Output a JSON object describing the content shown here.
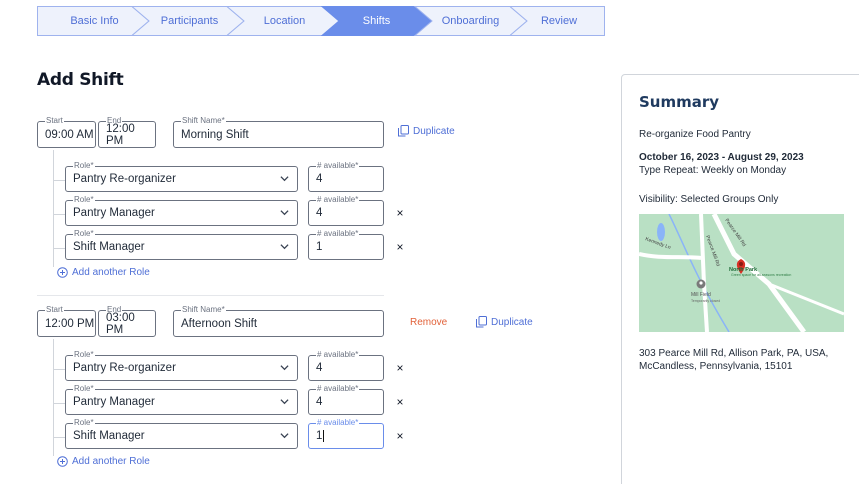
{
  "stepper": {
    "steps": [
      {
        "label": "Basic Info"
      },
      {
        "label": "Participants"
      },
      {
        "label": "Location"
      },
      {
        "label": "Shifts"
      },
      {
        "label": "Onboarding"
      },
      {
        "label": "Review"
      }
    ],
    "active_index": 3,
    "active_color": "#6a8dea"
  },
  "page": {
    "title": "Add Shift"
  },
  "labels": {
    "start": "Start",
    "end": "End",
    "shift_name": "Shift Name*",
    "role": "Role*",
    "available": "# available*",
    "duplicate": "Duplicate",
    "remove": "Remove",
    "add_role": "Add another Role",
    "remove_role": "×"
  },
  "shifts": [
    {
      "start": "09:00 AM",
      "end": "12:00 PM",
      "name": "Morning Shift",
      "roles": [
        {
          "role": "Pantry Re-organizer",
          "available": "4"
        },
        {
          "role": "Pantry Manager",
          "available": "4"
        },
        {
          "role": "Shift Manager",
          "available": "1"
        }
      ]
    },
    {
      "start": "12:00 PM",
      "end": "03:00 PM",
      "name": "Afternoon Shift",
      "roles": [
        {
          "role": "Pantry Re-organizer",
          "available": "4"
        },
        {
          "role": "Pantry Manager",
          "available": "4"
        },
        {
          "role": "Shift Manager",
          "available": "1"
        }
      ]
    }
  ],
  "summary": {
    "title": "Summary",
    "event_name": "Re-organize Food Pantry",
    "dates": "October 16, 2023 - August 29, 2023",
    "repeat": "Type Repeat: Weekly on Monday",
    "visibility": "Visibility: Selected Groups Only",
    "address_line1": "303 Pearce Mill Rd, Allison Park, PA, USA,",
    "address_line2": "McCandless, Pennsylvania, 15101",
    "map": {
      "road_label_1": "Pearce Mill Rd",
      "road_label_2": "Pearce Mill Rd",
      "road_label_3": "Kennedy Ln",
      "pin_label": "North Park",
      "pin_sublabel": "Green space for all-seasons recreation",
      "place_label": "Mill Field",
      "place_sublabel": "Temporarily closed",
      "pin_color": "#d93025"
    }
  },
  "colors": {
    "accent": "#4f6fd6",
    "danger": "#e2623a",
    "map_bg": "#b9e0c4"
  }
}
